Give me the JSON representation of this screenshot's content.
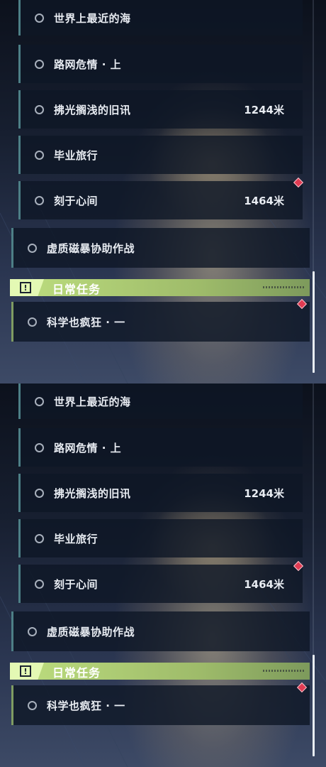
{
  "panels": [
    {
      "sub_quests": [
        {
          "label": "世界上最近的海",
          "distance": ""
        },
        {
          "label": "路网危情 · 上",
          "distance": ""
        },
        {
          "label": "拂光搁浅的旧讯",
          "distance": "1244米"
        },
        {
          "label": "毕业旅行",
          "distance": ""
        },
        {
          "label": "刻于心间",
          "distance": "1464米"
        }
      ],
      "main_quest": {
        "label": "虚质磁暴协助作战"
      },
      "daily_header": {
        "title": "日常任务",
        "icon": "exclamation-icon"
      },
      "daily_quests": [
        {
          "label": "科学也疯狂 · 一"
        }
      ]
    },
    {
      "sub_quests": [
        {
          "label": "世界上最近的海",
          "distance": ""
        },
        {
          "label": "路网危情 · 上",
          "distance": ""
        },
        {
          "label": "拂光搁浅的旧讯",
          "distance": "1244米"
        },
        {
          "label": "毕业旅行",
          "distance": ""
        },
        {
          "label": "刻于心间",
          "distance": "1464米"
        }
      ],
      "main_quest": {
        "label": "虚质磁暴协助作战"
      },
      "daily_header": {
        "title": "日常任务",
        "icon": "exclamation-icon"
      },
      "daily_quests": [
        {
          "label": "科学也疯狂 · 一"
        }
      ]
    }
  ],
  "colors": {
    "accent_green": "#c8ef8a",
    "quest_border": "#4d7f86",
    "alert_marker": "#e03b52"
  }
}
